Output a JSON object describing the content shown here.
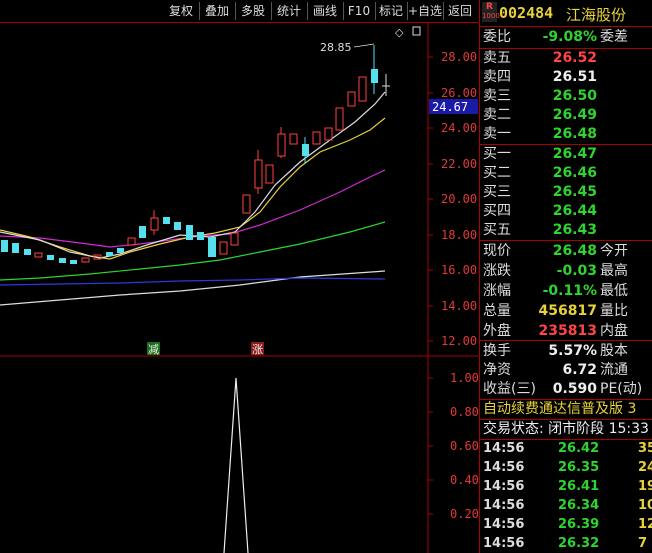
{
  "toolbar": {
    "buttons": [
      "复权",
      "叠加",
      "多股",
      "统计",
      "画线",
      "F10",
      "标记",
      "+自选",
      "返回"
    ]
  },
  "chart": {
    "price_axis": [
      "28.00",
      "26.00",
      "24.00",
      "22.00",
      "20.00",
      "18.00",
      "16.00",
      "14.00",
      "12.00"
    ],
    "current_price_tag": "24.67",
    "high_label": "28.85",
    "marker_left": "减",
    "marker_right": "涨",
    "indicator_axis": [
      "1.00",
      "0.80",
      "0.60",
      "0.40",
      "0.20"
    ],
    "diamond": "◇"
  },
  "header": {
    "badge_top": "R",
    "badge_bottom": "1000",
    "code": "002484",
    "name": "江海股份"
  },
  "order_ratio": {
    "label": "委比",
    "value": "-9.08%",
    "label2": "委差"
  },
  "asks": [
    {
      "label": "卖五",
      "price": "26.52"
    },
    {
      "label": "卖四",
      "price": "26.51"
    },
    {
      "label": "卖三",
      "price": "26.50"
    },
    {
      "label": "卖二",
      "price": "26.49"
    },
    {
      "label": "卖一",
      "price": "26.48"
    }
  ],
  "bids": [
    {
      "label": "买一",
      "price": "26.47"
    },
    {
      "label": "买二",
      "price": "26.46"
    },
    {
      "label": "买三",
      "price": "26.45"
    },
    {
      "label": "买四",
      "price": "26.44"
    },
    {
      "label": "买五",
      "price": "26.43"
    }
  ],
  "quote": [
    {
      "label": "现价",
      "value": "26.48",
      "label2": "今开"
    },
    {
      "label": "涨跌",
      "value": "-0.03",
      "label2": "最高"
    },
    {
      "label": "涨幅",
      "value": "-0.11%",
      "label2": "最低"
    },
    {
      "label": "总量",
      "value": "456817",
      "label2": "量比"
    },
    {
      "label": "外盘",
      "value": "235813",
      "label2": "内盘"
    }
  ],
  "stats": [
    {
      "label": "换手",
      "value": "5.57%",
      "label2": "股本"
    },
    {
      "label": "净资",
      "value": "6.72",
      "label2": "流通"
    },
    {
      "label": "收益(三)",
      "value": "0.590",
      "label2": "PE(动)"
    }
  ],
  "news_ticker": "自动续费通达信普及版 3",
  "trade_status": "交易状态: 闭市阶段 15:33",
  "ticks": [
    {
      "time": "14:56",
      "price": "26.42",
      "vol": "35"
    },
    {
      "time": "14:56",
      "price": "26.35",
      "vol": "24"
    },
    {
      "time": "14:56",
      "price": "26.41",
      "vol": "19"
    },
    {
      "time": "14:56",
      "price": "26.34",
      "vol": "10"
    },
    {
      "time": "14:56",
      "price": "26.39",
      "vol": "12"
    },
    {
      "time": "14:56",
      "price": "26.32",
      "vol": "7"
    }
  ]
}
